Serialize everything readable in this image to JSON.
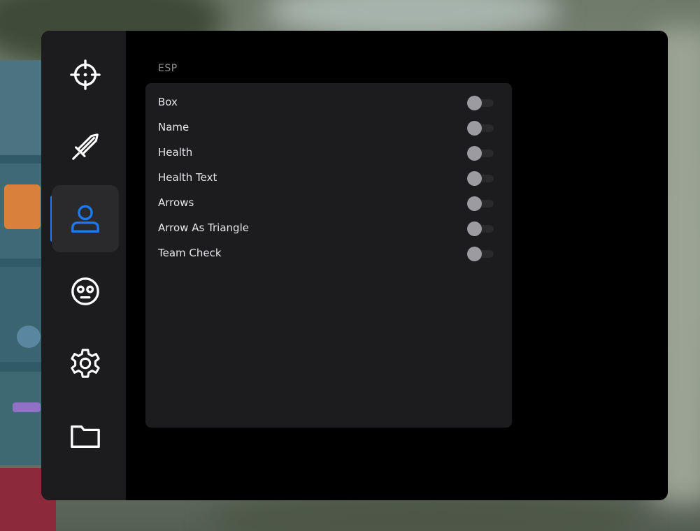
{
  "colors": {
    "accent": "#1d7af2",
    "icon": "#ffffff",
    "panel": "#000000",
    "card": "#1c1b1d",
    "text": "#e7e6ea",
    "muted": "#8e8d92",
    "toggle_knob": "#9c9ba0"
  },
  "sidebar": {
    "items": [
      {
        "icon": "crosshair-icon",
        "active": false
      },
      {
        "icon": "sword-icon",
        "active": false
      },
      {
        "icon": "user-icon",
        "active": true
      },
      {
        "icon": "face-icon",
        "active": false
      },
      {
        "icon": "gear-icon",
        "active": false
      },
      {
        "icon": "folder-icon",
        "active": false
      }
    ]
  },
  "esp": {
    "title": "ESP",
    "options": [
      {
        "label": "Box",
        "enabled": false
      },
      {
        "label": "Name",
        "enabled": false
      },
      {
        "label": "Health",
        "enabled": false
      },
      {
        "label": "Health Text",
        "enabled": false
      },
      {
        "label": "Arrows",
        "enabled": false
      },
      {
        "label": "Arrow As Triangle",
        "enabled": false
      },
      {
        "label": "Team Check",
        "enabled": false
      }
    ]
  }
}
